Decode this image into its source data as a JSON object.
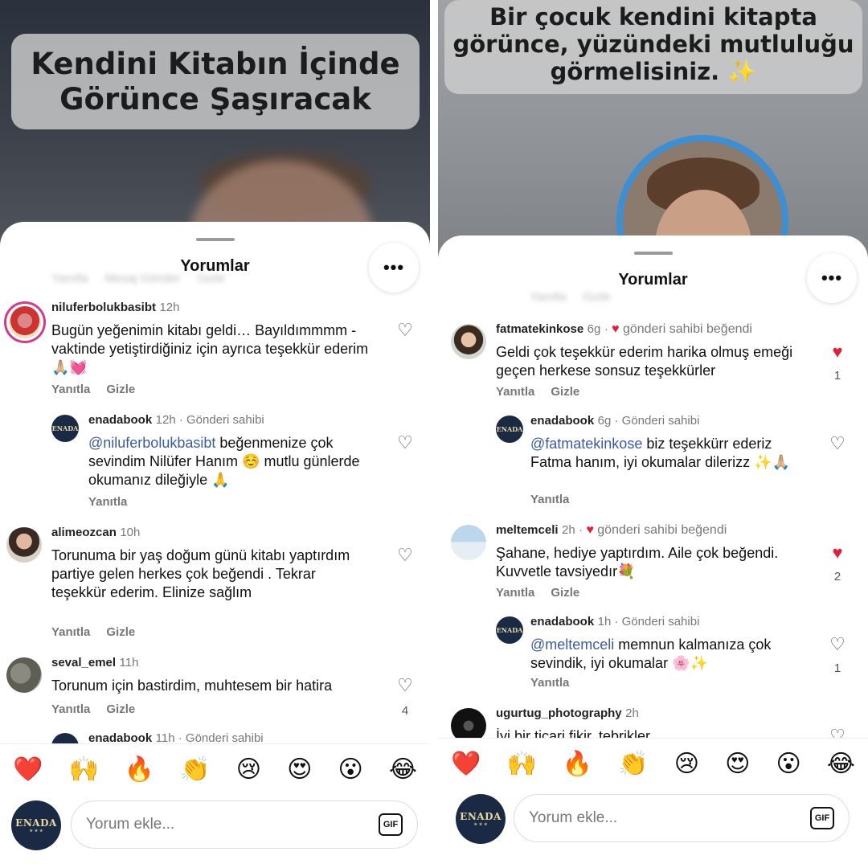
{
  "left": {
    "story_title": "Kendini Kitabın İçinde Görünce Şaşıracak",
    "sheet_title": "Yorumlar",
    "more_label": "•••",
    "ghost_actions": [
      "Yanıtla",
      "Mesaj Gönder",
      "Gizle"
    ],
    "comments": [
      {
        "user": "niluferbolukbasibt",
        "time": "12h",
        "text": "Bugün yeğenimin kitabı geldi… Bayıldımmmm - vaktinde yetiştirdiğiniz için ayrıca teşekkür ederim🙏🏼💓",
        "actions": [
          "Yanıtla",
          "Gizle"
        ]
      },
      {
        "user": "enadabook",
        "time": "12h",
        "owner": "Gönderi sahibi",
        "mention": "@niluferbolukbasibt",
        "text": " beğenmenize çok sevindim Nilüfer Hanım ☺️ mutlu günlerde okumanız dileğiyle 🙏",
        "actions": [
          "Yanıtla"
        ]
      },
      {
        "user": "alimeozcan",
        "time": "10h",
        "text": "Torunuma bir yaş doğum günü kitabı yaptırdım partiye gelen herkes çok beğendi . Tekrar teşekkür ederim. Elinize sağlım",
        "actions": [
          "Yanıtla",
          "Gizle"
        ]
      },
      {
        "user": "seval_emel",
        "time": "11h",
        "text": "Torunum için bastirdim, muhtesem bir hatira",
        "actions": [
          "Yanıtla",
          "Gizle"
        ],
        "likes": "4"
      },
      {
        "user": "enadabook",
        "time": "11h",
        "owner": "Gönderi sahibi"
      }
    ],
    "emojis": [
      "❤️",
      "🙌",
      "🔥",
      "👏",
      "😢",
      "😍",
      "😮",
      "😂"
    ],
    "input_placeholder": "Yorum ekle...",
    "gif_label": "GIF",
    "brand": "ENADA"
  },
  "right": {
    "story_title": "Bir çocuk kendini kitapta görünce, yüzündeki mutluluğu görmelisiniz. ✨",
    "sheet_title": "Yorumlar",
    "more_label": "•••",
    "ghost_actions": [
      "Yanıtla",
      "Gizle"
    ],
    "comments": [
      {
        "user": "fatmatekinkose",
        "time": "6g",
        "owner_liked": "gönderi sahibi beğendi",
        "text": "Geldi çok teşekkür ederim harika olmuş emeği geçen  herkese sonsuz teşekkürler",
        "actions": [
          "Yanıtla",
          "Gizle"
        ],
        "likes": "1"
      },
      {
        "user": "enadabook",
        "time": "6g",
        "owner": "Gönderi sahibi",
        "mention": "@fatmatekinkose",
        "text": " biz teşekkürr ederiz Fatma hanım, iyi okumalar dilerizz ✨🙏🏼",
        "actions": [
          "Yanıtla"
        ]
      },
      {
        "user": "meltemceli",
        "time": "2h",
        "owner_liked": "gönderi sahibi beğendi",
        "text": "Şahane, hediye yaptırdım. Aile çok beğendi. Kuvvetle tavsiyedır💐",
        "actions": [
          "Yanıtla",
          "Gizle"
        ],
        "likes": "2"
      },
      {
        "user": "enadabook",
        "time": "1h",
        "owner": "Gönderi sahibi",
        "mention": "@meltemceli",
        "text": " memnun kalmanıza çok sevindik, iyi okumalar 🌸✨",
        "actions": [
          "Yanıtla"
        ],
        "likes": "1"
      },
      {
        "user": "ugurtug_photography",
        "time": "2h",
        "text": "İyi bir ticari fikir, tebrikler"
      }
    ],
    "emojis": [
      "❤️",
      "🙌",
      "🔥",
      "👏",
      "😢",
      "😍",
      "😮",
      "😂"
    ],
    "input_placeholder": "Yorum ekle...",
    "gif_label": "GIF",
    "brand": "ENADA"
  },
  "colors": {
    "like_red": "#e0203a",
    "mention_blue": "#3b5b9a",
    "brand_navy": "#1b2a44"
  }
}
